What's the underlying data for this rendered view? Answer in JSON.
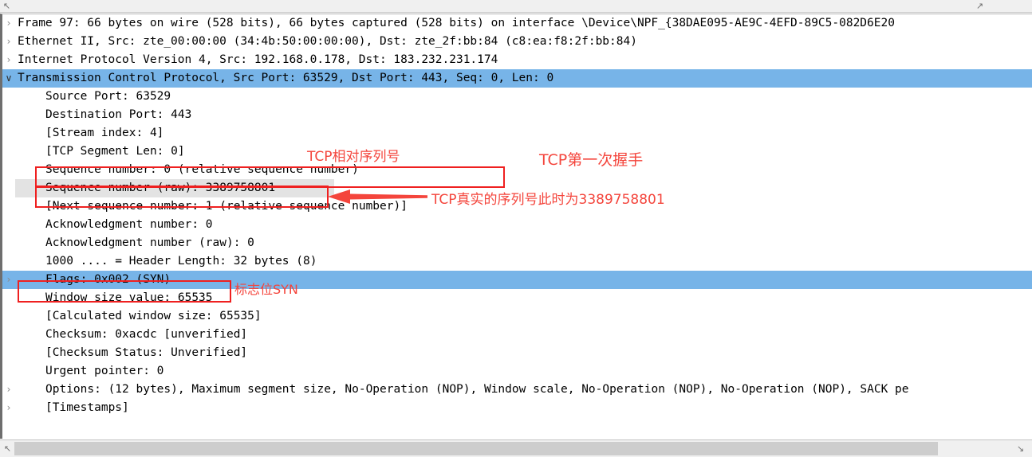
{
  "window": {
    "app": "Wireshark",
    "pane": "packet-details"
  },
  "top_strip": {
    "left_arrow": "↖",
    "right_arrow": "↗"
  },
  "tree": {
    "rows": [
      {
        "id": "frame",
        "level": 0,
        "expander": "collapsed",
        "expander_glyph": "›",
        "selected": false,
        "hovered": false,
        "text": "Frame 97: 66 bytes on wire (528 bits), 66 bytes captured (528 bits) on interface \\Device\\NPF_{38DAE095-AE9C-4EFD-89C5-082D6E20"
      },
      {
        "id": "ethernet",
        "level": 0,
        "expander": "collapsed",
        "expander_glyph": "›",
        "selected": false,
        "hovered": false,
        "text": "Ethernet II, Src: zte_00:00:00 (34:4b:50:00:00:00), Dst: zte_2f:bb:84 (c8:ea:f8:2f:bb:84)"
      },
      {
        "id": "ipv4",
        "level": 0,
        "expander": "collapsed",
        "expander_glyph": "›",
        "selected": false,
        "hovered": false,
        "text": "Internet Protocol Version 4, Src: 192.168.0.178, Dst: 183.232.231.174"
      },
      {
        "id": "tcp",
        "level": 0,
        "expander": "expanded",
        "expander_glyph": "∨",
        "selected": true,
        "hovered": false,
        "text": "Transmission Control Protocol, Src Port: 63529, Dst Port: 443, Seq: 0, Len: 0"
      },
      {
        "id": "source-port",
        "level": 1,
        "expander": "none",
        "expander_glyph": "",
        "selected": false,
        "hovered": false,
        "text": "Source Port: 63529"
      },
      {
        "id": "destination-port",
        "level": 1,
        "expander": "none",
        "expander_glyph": "",
        "selected": false,
        "hovered": false,
        "text": "Destination Port: 443"
      },
      {
        "id": "stream-index",
        "level": 1,
        "expander": "none",
        "expander_glyph": "",
        "selected": false,
        "hovered": false,
        "text": "[Stream index: 4]"
      },
      {
        "id": "tcp-segment-len",
        "level": 1,
        "expander": "none",
        "expander_glyph": "",
        "selected": false,
        "hovered": false,
        "text": "[TCP Segment Len: 0]"
      },
      {
        "id": "sequence-number",
        "level": 1,
        "expander": "none",
        "expander_glyph": "",
        "selected": false,
        "hovered": false,
        "text": "Sequence number: 0    (relative sequence number)"
      },
      {
        "id": "sequence-number-raw",
        "level": 1,
        "expander": "none",
        "expander_glyph": "",
        "selected": false,
        "hovered": true,
        "text": "Sequence number (raw): 3389758801"
      },
      {
        "id": "next-sequence-number",
        "level": 1,
        "expander": "none",
        "expander_glyph": "",
        "selected": false,
        "hovered": false,
        "text": "[Next sequence number: 1    (relative sequence number)]"
      },
      {
        "id": "acknowledgment-number",
        "level": 1,
        "expander": "none",
        "expander_glyph": "",
        "selected": false,
        "hovered": false,
        "text": "Acknowledgment number: 0"
      },
      {
        "id": "acknowledgment-number-raw",
        "level": 1,
        "expander": "none",
        "expander_glyph": "",
        "selected": false,
        "hovered": false,
        "text": "Acknowledgment number (raw): 0"
      },
      {
        "id": "header-length",
        "level": 1,
        "expander": "none",
        "expander_glyph": "",
        "selected": false,
        "hovered": false,
        "text": "1000 .... = Header Length: 32 bytes (8)"
      },
      {
        "id": "flags",
        "level": 1,
        "expander": "collapsed",
        "expander_glyph": "›",
        "selected": true,
        "hovered": false,
        "text": "Flags: 0x002 (SYN)"
      },
      {
        "id": "window-size-value",
        "level": 1,
        "expander": "none",
        "expander_glyph": "",
        "selected": false,
        "hovered": false,
        "text": "Window size value: 65535"
      },
      {
        "id": "calculated-window-size",
        "level": 1,
        "expander": "none",
        "expander_glyph": "",
        "selected": false,
        "hovered": false,
        "text": "[Calculated window size: 65535]"
      },
      {
        "id": "checksum",
        "level": 1,
        "expander": "none",
        "expander_glyph": "",
        "selected": false,
        "hovered": false,
        "text": "Checksum: 0xacdc [unverified]"
      },
      {
        "id": "checksum-status",
        "level": 1,
        "expander": "none",
        "expander_glyph": "",
        "selected": false,
        "hovered": false,
        "text": "[Checksum Status: Unverified]"
      },
      {
        "id": "urgent-pointer",
        "level": 1,
        "expander": "none",
        "expander_glyph": "",
        "selected": false,
        "hovered": false,
        "text": "Urgent pointer: 0"
      },
      {
        "id": "options",
        "level": 1,
        "expander": "collapsed",
        "expander_glyph": "›",
        "selected": false,
        "hovered": false,
        "text": "Options: (12 bytes), Maximum segment size, No-Operation (NOP), Window scale, No-Operation (NOP), No-Operation (NOP), SACK pe"
      },
      {
        "id": "timestamps",
        "level": 1,
        "expander": "collapsed",
        "expander_glyph": "›",
        "selected": false,
        "hovered": false,
        "text": "[Timestamps]"
      }
    ]
  },
  "annotations": {
    "color": "#f4453c",
    "box_color": "#ef2020",
    "relative_seq": "TCP相对序列号",
    "first_handshake": "TCP第一次握手",
    "raw_seq": "TCP真实的序列号此时为3389758801",
    "syn_flag": "标志位SYN"
  },
  "scrollbar": {
    "left_arrow": "↖",
    "right_arrow": "↘"
  },
  "colors": {
    "selection_blue": "#77b4e8",
    "hover_gray": "#e3e3e3",
    "annotation_red": "#f4453c"
  }
}
